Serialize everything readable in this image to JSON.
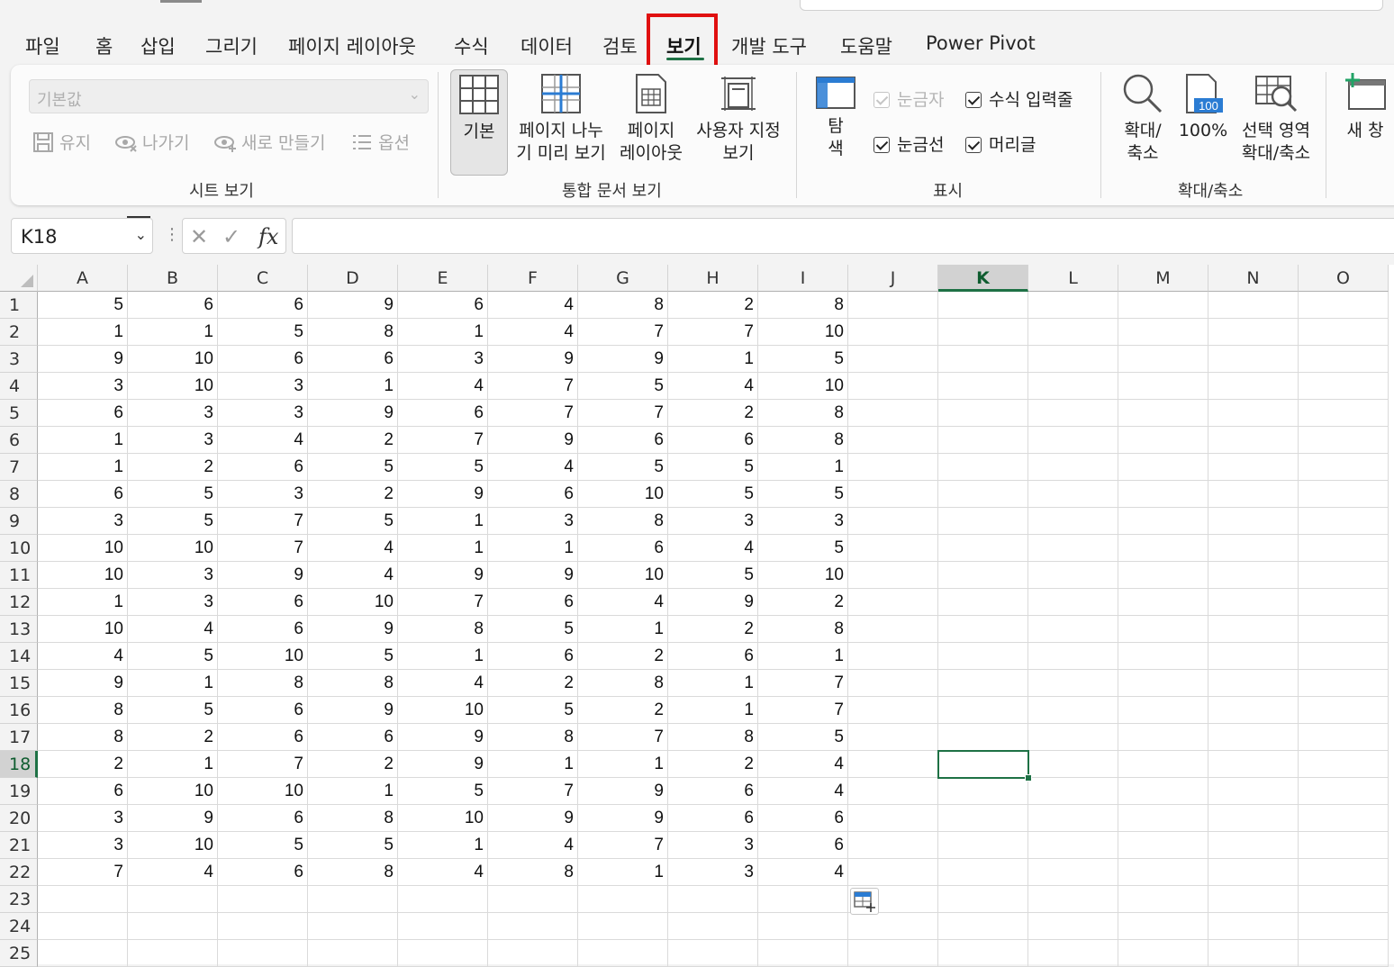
{
  "menu": {
    "tabs": [
      "파일",
      "홈",
      "삽입",
      "그리기",
      "페이지 레이아웃",
      "수식",
      "데이터",
      "검토",
      "보기",
      "개발 도구",
      "도움말",
      "Power Pivot"
    ],
    "active": "보기"
  },
  "ribbon": {
    "sheet_view": {
      "dropdown_value": "기본값",
      "keep": "유지",
      "exit": "나가기",
      "new": "새로 만들기",
      "options": "옵션",
      "label": "시트 보기"
    },
    "workbook_views": {
      "normal": "기본",
      "page_break_1": "페이지 나누",
      "page_break_2": "기 미리 보기",
      "page_layout_1": "페이지",
      "page_layout_2": "레이아웃",
      "custom_1": "사용자 지정",
      "custom_2": "보기",
      "label": "통합 문서 보기"
    },
    "show": {
      "navigation_1": "탐",
      "navigation_2": "색",
      "ruler": "눈금자",
      "formula_bar": "수식 입력줄",
      "gridlines": "눈금선",
      "headings": "머리글",
      "label": "표시"
    },
    "zoom": {
      "zoom_1": "확대/",
      "zoom_2": "축소",
      "hundred": "100%",
      "icon_100": "100",
      "selection_1": "선택 영역",
      "selection_2": "확대/축소",
      "label": "확대/축소"
    },
    "window": {
      "new_window": "새 창"
    }
  },
  "formula_bar": {
    "name_box": "K18",
    "formula": ""
  },
  "sheet": {
    "columns": [
      "A",
      "B",
      "C",
      "D",
      "E",
      "F",
      "G",
      "H",
      "I",
      "J",
      "K",
      "L",
      "M",
      "N",
      "O"
    ],
    "rows": [
      "1",
      "2",
      "3",
      "4",
      "5",
      "6",
      "7",
      "8",
      "9",
      "10",
      "11",
      "12",
      "13",
      "14",
      "15",
      "16",
      "17",
      "18",
      "19",
      "20",
      "21",
      "22",
      "23",
      "24",
      "25"
    ],
    "selected_column": "K",
    "selected_row": "18",
    "data": [
      [
        5,
        6,
        6,
        9,
        6,
        4,
        8,
        2,
        8
      ],
      [
        1,
        1,
        5,
        8,
        1,
        4,
        7,
        7,
        10
      ],
      [
        9,
        10,
        6,
        6,
        3,
        9,
        9,
        1,
        5
      ],
      [
        3,
        10,
        3,
        1,
        4,
        7,
        5,
        4,
        10
      ],
      [
        6,
        3,
        3,
        9,
        6,
        7,
        7,
        2,
        8
      ],
      [
        1,
        3,
        4,
        2,
        7,
        9,
        6,
        6,
        8
      ],
      [
        1,
        2,
        6,
        5,
        5,
        4,
        5,
        5,
        1
      ],
      [
        6,
        5,
        3,
        2,
        9,
        6,
        10,
        5,
        5
      ],
      [
        3,
        5,
        7,
        5,
        1,
        3,
        8,
        3,
        3
      ],
      [
        10,
        10,
        7,
        4,
        1,
        1,
        6,
        4,
        5
      ],
      [
        10,
        3,
        9,
        4,
        9,
        9,
        10,
        5,
        10
      ],
      [
        1,
        3,
        6,
        10,
        7,
        6,
        4,
        9,
        2
      ],
      [
        10,
        4,
        6,
        9,
        8,
        5,
        1,
        2,
        8
      ],
      [
        4,
        5,
        10,
        5,
        1,
        6,
        2,
        6,
        1
      ],
      [
        9,
        1,
        8,
        8,
        4,
        2,
        8,
        1,
        7
      ],
      [
        8,
        5,
        6,
        9,
        10,
        5,
        2,
        1,
        7
      ],
      [
        8,
        2,
        6,
        6,
        9,
        8,
        7,
        8,
        5
      ],
      [
        2,
        1,
        7,
        2,
        9,
        1,
        1,
        2,
        4
      ],
      [
        6,
        10,
        10,
        1,
        5,
        7,
        9,
        6,
        4
      ],
      [
        3,
        9,
        6,
        8,
        10,
        9,
        9,
        6,
        6
      ],
      [
        3,
        10,
        5,
        5,
        1,
        4,
        7,
        3,
        6
      ],
      [
        7,
        4,
        6,
        8,
        4,
        8,
        1,
        3,
        4
      ]
    ]
  },
  "colors": {
    "accent": "#1e7145",
    "highlight": "#e01010"
  }
}
